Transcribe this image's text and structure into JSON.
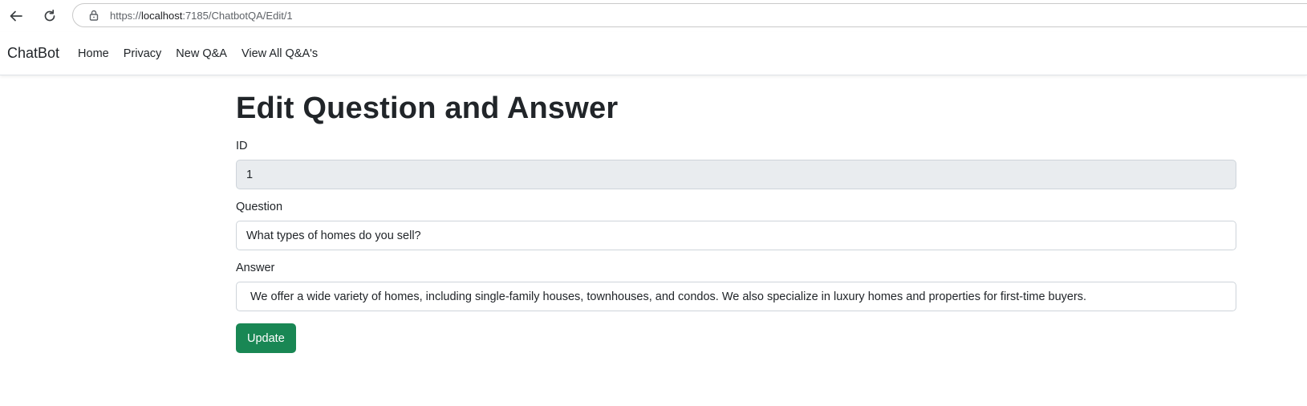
{
  "browser": {
    "url_scheme": "https://",
    "url_host": "localhost",
    "url_rest": ":7185/ChatbotQA/Edit/1",
    "icons": {
      "back": "back-arrow-icon",
      "reload": "reload-icon",
      "lock": "lock-icon"
    }
  },
  "navbar": {
    "brand": "ChatBot",
    "links": [
      "Home",
      "Privacy",
      "New Q&A",
      "View All Q&A's"
    ]
  },
  "main": {
    "title": "Edit Question and Answer",
    "fields": {
      "id": {
        "label": "ID",
        "value": "1"
      },
      "question": {
        "label": "Question",
        "value": "What types of homes do you sell?"
      },
      "answer": {
        "label": "Answer",
        "value": "We offer a wide variety of homes, including single-family houses, townhouses, and condos. We also specialize in luxury homes and properties for first-time buyers."
      }
    },
    "submit_label": "Update"
  },
  "colors": {
    "primary_button": "#198754",
    "readonly_bg": "#e9ecef",
    "text": "#212529"
  }
}
